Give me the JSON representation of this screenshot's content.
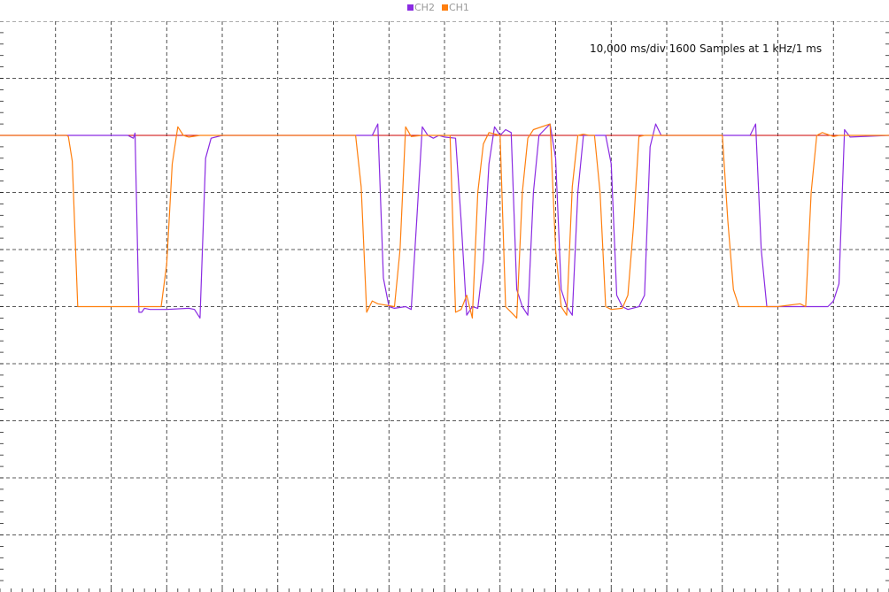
{
  "legend": [
    {
      "name": "CH2",
      "color": "#8a2be2"
    },
    {
      "name": "CH1",
      "color": "#ff7f0e"
    }
  ],
  "info_text": "10,000 ms/div 1600 Samples at 1 kHz/1 ms",
  "colors": {
    "grid": "#222222",
    "reference": "#cc0000",
    "background": "#ffffff"
  },
  "chart_data": {
    "type": "line",
    "grid": true,
    "grid_style": "dashed",
    "xlim": [
      0,
      160
    ],
    "ylim": [
      -8,
      2
    ],
    "reference_line": 0,
    "series": [
      {
        "name": "CH2",
        "color": "#8a2be2",
        "points": [
          [
            0,
            0
          ],
          [
            23,
            0
          ],
          [
            24,
            -0.05
          ],
          [
            24.3,
            0.04
          ],
          [
            25,
            -3.1
          ],
          [
            25.5,
            -3.1
          ],
          [
            26,
            -3.03
          ],
          [
            27,
            -3.05
          ],
          [
            30,
            -3.05
          ],
          [
            34,
            -3.03
          ],
          [
            35,
            -3.05
          ],
          [
            36,
            -3.2
          ],
          [
            37,
            -0.4
          ],
          [
            38,
            -0.05
          ],
          [
            40,
            0
          ],
          [
            67,
            0
          ],
          [
            68,
            0.2
          ],
          [
            69,
            -2.5
          ],
          [
            70,
            -3.0
          ],
          [
            71,
            -3.03
          ],
          [
            73,
            -3.0
          ],
          [
            74,
            -3.05
          ],
          [
            75,
            -1.5
          ],
          [
            76,
            0.15
          ],
          [
            77,
            0
          ],
          [
            78,
            -0.05
          ],
          [
            79,
            0
          ],
          [
            80,
            -0.03
          ],
          [
            82,
            -0.05
          ],
          [
            83,
            -1.5
          ],
          [
            84,
            -3.15
          ],
          [
            85,
            -3.0
          ],
          [
            86,
            -3.03
          ],
          [
            87,
            -2.2
          ],
          [
            88,
            -0.5
          ],
          [
            89,
            0.15
          ],
          [
            90,
            0
          ],
          [
            91,
            0.1
          ],
          [
            92,
            0.05
          ],
          [
            93,
            -2.7
          ],
          [
            94,
            -3.0
          ],
          [
            95,
            -3.15
          ],
          [
            96,
            -1.0
          ],
          [
            97,
            0
          ],
          [
            98,
            0.1
          ],
          [
            99,
            0.2
          ],
          [
            100,
            -0.4
          ],
          [
            101,
            -2.7
          ],
          [
            102,
            -3.0
          ],
          [
            103,
            -3.15
          ],
          [
            104,
            -1.0
          ],
          [
            105,
            0
          ],
          [
            106,
            0
          ],
          [
            107,
            0
          ],
          [
            108,
            0
          ],
          [
            109,
            0
          ],
          [
            110,
            -0.5
          ],
          [
            111,
            -2.8
          ],
          [
            112,
            -3.0
          ],
          [
            113,
            -3.05
          ],
          [
            115,
            -3.0
          ],
          [
            116,
            -2.8
          ],
          [
            117,
            -0.2
          ],
          [
            118,
            0.2
          ],
          [
            119,
            0
          ],
          [
            120,
            0
          ],
          [
            135,
            0
          ],
          [
            136,
            0.2
          ],
          [
            137,
            -2.0
          ],
          [
            138,
            -3.0
          ],
          [
            139,
            -3.0
          ],
          [
            145,
            -3.0
          ],
          [
            149,
            -3.0
          ],
          [
            150,
            -2.9
          ],
          [
            151,
            -2.6
          ],
          [
            152,
            0.1
          ],
          [
            153,
            -0.03
          ],
          [
            160,
            0
          ]
        ]
      },
      {
        "name": "CH1",
        "color": "#ff7f0e",
        "points": [
          [
            0,
            0
          ],
          [
            12,
            0
          ],
          [
            12.3,
            -0.02
          ],
          [
            13,
            -0.45
          ],
          [
            14,
            -3.0
          ],
          [
            20,
            -3.0
          ],
          [
            29,
            -3.0
          ],
          [
            30,
            -2.25
          ],
          [
            31,
            -0.5
          ],
          [
            32,
            0.15
          ],
          [
            33,
            0
          ],
          [
            34,
            -0.03
          ],
          [
            36,
            0
          ],
          [
            64,
            0
          ],
          [
            65,
            -0.9
          ],
          [
            66,
            -3.1
          ],
          [
            67,
            -2.9
          ],
          [
            68,
            -2.95
          ],
          [
            71,
            -3.0
          ],
          [
            72,
            -2.0
          ],
          [
            73,
            0.15
          ],
          [
            74,
            -0.02
          ],
          [
            76,
            0
          ],
          [
            81,
            0
          ],
          [
            82,
            -3.1
          ],
          [
            83,
            -3.05
          ],
          [
            84,
            -2.8
          ],
          [
            85,
            -3.2
          ],
          [
            86,
            -1.0
          ],
          [
            87,
            -0.15
          ],
          [
            88,
            0.05
          ],
          [
            90,
            0
          ],
          [
            91,
            -3.0
          ],
          [
            92,
            -3.1
          ],
          [
            93,
            -3.2
          ],
          [
            94,
            -1.0
          ],
          [
            95,
            -0.05
          ],
          [
            96,
            0.1
          ],
          [
            99,
            0.2
          ],
          [
            100,
            -2.0
          ],
          [
            101,
            -3.0
          ],
          [
            102,
            -3.15
          ],
          [
            103,
            -0.9
          ],
          [
            104,
            0
          ],
          [
            105,
            0.02
          ],
          [
            106,
            0
          ],
          [
            107,
            0
          ],
          [
            108,
            -1.0
          ],
          [
            109,
            -3.0
          ],
          [
            110,
            -3.05
          ],
          [
            112,
            -3.03
          ],
          [
            113,
            -2.8
          ],
          [
            114,
            -1.6
          ],
          [
            115,
            -0.02
          ],
          [
            116,
            0
          ],
          [
            130,
            0
          ],
          [
            131,
            -1.5
          ],
          [
            132,
            -2.7
          ],
          [
            133,
            -3.0
          ],
          [
            135,
            -3.0
          ],
          [
            140,
            -3.0
          ],
          [
            144,
            -2.95
          ],
          [
            145,
            -3.0
          ],
          [
            146,
            -1.0
          ],
          [
            147,
            0
          ],
          [
            148,
            0.05
          ],
          [
            150,
            -0.02
          ],
          [
            151,
            0
          ],
          [
            160,
            0
          ]
        ]
      }
    ]
  }
}
